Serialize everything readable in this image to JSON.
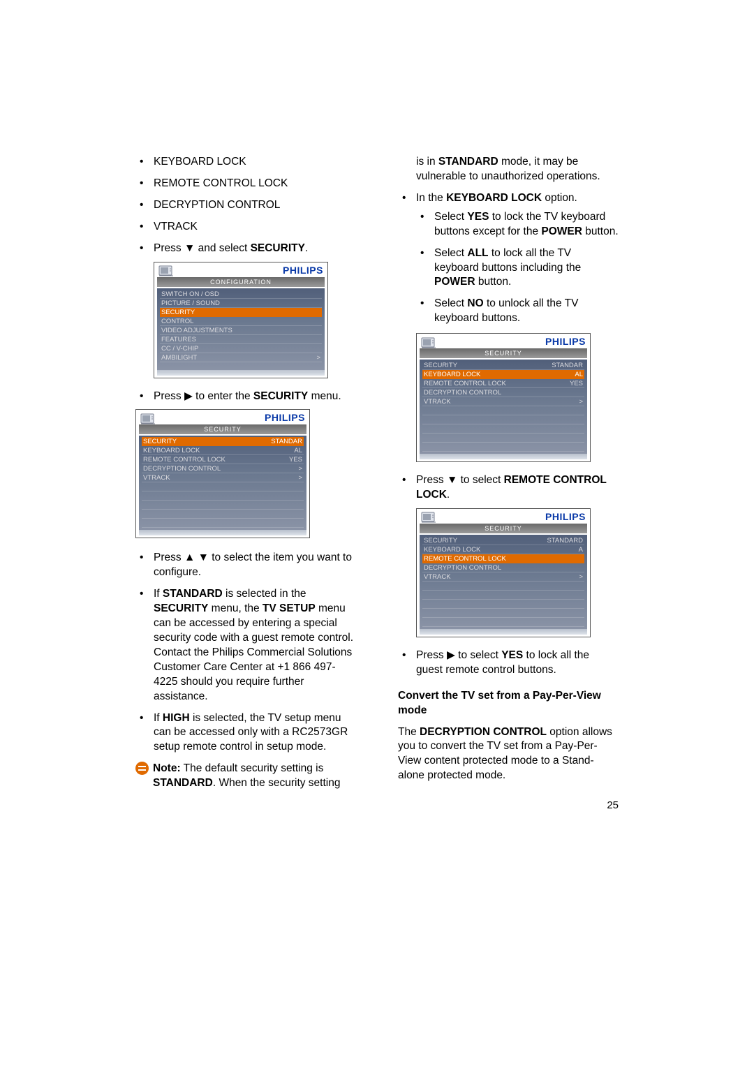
{
  "col1": {
    "items": [
      "KEYBOARD LOCK",
      "REMOTE CONTROL LOCK",
      "DECRYPTION CONTROL",
      "VTRACK"
    ],
    "press_select_pre": "Press ",
    "press_select_arrow": "▼",
    "press_select_mid": " and select ",
    "press_select_b": "SECURITY",
    "press_select_post": "."
  },
  "osd_brand": "PHILIPS",
  "osd1": {
    "title": "CONFIGURATION",
    "rows": [
      {
        "l": "SWITCH ON / OSD",
        "r": ""
      },
      {
        "l": "PICTURE  /  SOUND",
        "r": ""
      },
      {
        "l": "SECURITY",
        "r": "",
        "hl": true
      },
      {
        "l": "CONTROL",
        "r": ""
      },
      {
        "l": "VIDEO ADJUSTMENTS",
        "r": ""
      },
      {
        "l": "FEATURES",
        "r": ""
      },
      {
        "l": "CC / V-CHIP",
        "r": ""
      },
      {
        "l": "AMBILIGHT",
        "r": ">"
      }
    ]
  },
  "enter_sec_pre": "Press ",
  "enter_sec_arrow": "▶",
  "enter_sec_mid": " to enter the ",
  "enter_sec_b": "SECURITY",
  "enter_sec_post": " menu.",
  "osd2": {
    "title": "SECURITY",
    "rows": [
      {
        "l": "SECURITY",
        "r": "STANDAR",
        "hl": true
      },
      {
        "l": "KEYBOARD LOCK",
        "r": "AL"
      },
      {
        "l": "REMOTE CONTROL LOCK",
        "r": "YES"
      },
      {
        "l": "DECRYPTION CONTROL",
        "r": ">"
      },
      {
        "l": "VTRACK",
        "r": ">"
      }
    ]
  },
  "sel_item_pre": "Press ",
  "sel_item_arr": "▲  ▼",
  "sel_item_post": " to select the item you want to configure.",
  "std_1": "If ",
  "std_b1": "STANDARD",
  "std_2": " is selected in the ",
  "std_b2": "SECURITY",
  "std_3": " menu, the ",
  "std_b3": "TV SETUP",
  "std_4": " menu can be accessed by entering a special security code with a guest remote control. Contact the Philips Commercial Solutions Customer Care Center at +1 866 497-4225 should you require further assistance.",
  "high_1": "If ",
  "high_b": "HIGH",
  "high_2": " is selected, the TV setup menu can be accessed only with a RC2573GR setup remote control in setup mode.",
  "note_b": "Note:",
  "note_1": " The default security setting is ",
  "note_b2": "STANDARD",
  "note_2": ". When the security setting ",
  "col2": {
    "cont_1": "is in ",
    "cont_b": "STANDARD",
    "cont_2": " mode, it may be vulnerable to unauthorized operations.",
    "kbopt_1": "In the ",
    "kbopt_b": "KEYBOARD LOCK",
    "kbopt_2": " option.",
    "kb_yes_1": "Select ",
    "kb_yes_b": "YES",
    "kb_yes_2": " to lock the TV keyboard buttons except for the ",
    "kb_yes_b2": "POWER",
    "kb_yes_3": " button.",
    "kb_all_1": "Select ",
    "kb_all_b": "ALL",
    "kb_all_2": " to lock all the TV keyboard buttons including the ",
    "kb_all_b2": "POWER",
    "kb_all_3": " button.",
    "kb_no_1": "Select ",
    "kb_no_b": "NO",
    "kb_no_2": " to unlock all the TV keyboard buttons."
  },
  "osd3": {
    "title": "SECURITY",
    "rows": [
      {
        "l": "SECURITY",
        "r": "STANDAR"
      },
      {
        "l": "KEYBOARD LOCK",
        "r": "AL",
        "hl": true
      },
      {
        "l": "REMOTE CONTROL LOCK",
        "r": "YES"
      },
      {
        "l": "DECRYPTION CONTROL",
        "r": ""
      },
      {
        "l": "VTRACK",
        "r": ">"
      }
    ]
  },
  "rcl_pre": "Press ",
  "rcl_arrow": "▼",
  "rcl_mid": " to select ",
  "rcl_b": "REMOTE CONTROL LOCK",
  "rcl_post": ".",
  "osd4": {
    "title": "SECURITY",
    "rows": [
      {
        "l": "SECURITY",
        "r": "STANDARD"
      },
      {
        "l": "KEYBOARD LOCK",
        "r": "A"
      },
      {
        "l": "REMOTE CONTROL LOCK",
        "r": "",
        "hl": true
      },
      {
        "l": "DECRYPTION CONTROL",
        "r": ""
      },
      {
        "l": "VTRACK",
        "r": ">"
      }
    ]
  },
  "yes_pre": "Press ",
  "yes_arrow": "▶",
  "yes_mid": " to select ",
  "yes_b": "YES",
  "yes_post": " to lock all the guest remote control buttons.",
  "conv_head": "Convert the TV set from a Pay-Per-View mode",
  "conv_1": "The ",
  "conv_b": "DECRYPTION CONTROL",
  "conv_2": " option allows you to convert the TV set from a Pay-Per-View content protected mode to a Stand-alone protected mode.",
  "page_num": "25"
}
